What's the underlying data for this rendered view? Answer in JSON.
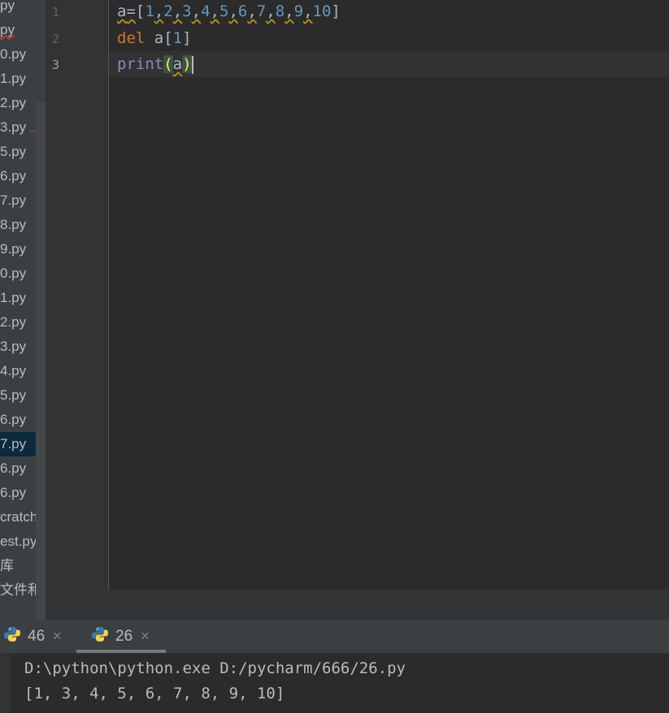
{
  "project_tree": {
    "items": [
      {
        "label": "py"
      },
      {
        "label": "py"
      },
      {
        "label": "0.py"
      },
      {
        "label": "1.py"
      },
      {
        "label": "2.py"
      },
      {
        "label": "3.py"
      },
      {
        "label": "5.py"
      },
      {
        "label": "6.py"
      },
      {
        "label": "7.py"
      },
      {
        "label": "8.py"
      },
      {
        "label": "9.py"
      },
      {
        "label": "0.py"
      },
      {
        "label": "1.py"
      },
      {
        "label": "2.py"
      },
      {
        "label": "3.py"
      },
      {
        "label": "4.py"
      },
      {
        "label": "5.py"
      },
      {
        "label": "6.py"
      },
      {
        "label": "7.py"
      },
      {
        "label": "6.py"
      },
      {
        "label": "6.py"
      },
      {
        "label": "cratch.py"
      },
      {
        "label": "est.py"
      },
      {
        "label": "库"
      },
      {
        "label": "文件和控制台"
      }
    ]
  },
  "editor": {
    "line_numbers": [
      "1",
      "2",
      "3"
    ],
    "line1": {
      "var": "a",
      "eq": "=",
      "open": "[",
      "close": "]",
      "sep": ",",
      "nums": [
        "1",
        "2",
        "3",
        "4",
        "5",
        "6",
        "7",
        "8",
        "9",
        "10"
      ]
    },
    "line2": {
      "kw": "del",
      "rest": " a[",
      "num": "1",
      "end": "]"
    },
    "line3": {
      "fn": "print",
      "open": "(",
      "arg": "a",
      "close": ")"
    }
  },
  "run_tabs": [
    {
      "label": "46",
      "close": "×",
      "icon": "python-icon"
    },
    {
      "label": "26",
      "close": "×",
      "icon": "python-icon"
    }
  ],
  "console": {
    "command": "D:\\python\\python.exe D:/pycharm/666/26.py",
    "output": "[1, 3, 4, 5, 6, 7, 8, 9, 10]"
  },
  "colors": {
    "background": "#2b2b2b",
    "keyword": "#cc7832",
    "number": "#6897bb",
    "builtin": "#8888c6",
    "text": "#a9b7c6"
  }
}
